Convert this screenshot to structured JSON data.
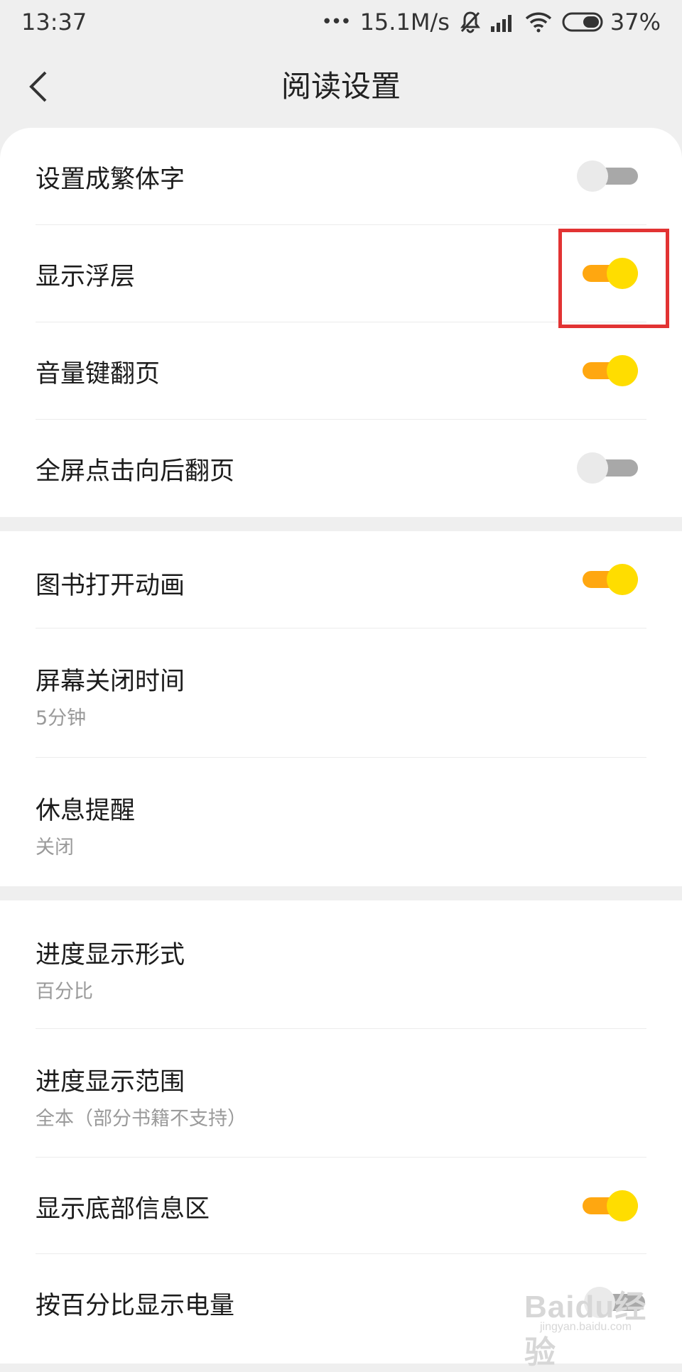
{
  "status_bar": {
    "time": "13:37",
    "dots": "•••",
    "speed": "15.1M/s",
    "battery_percent": "37%",
    "icons": [
      "more-dots-icon",
      "mute-bell-icon",
      "signal-icon",
      "wifi-icon",
      "battery-icon"
    ]
  },
  "nav": {
    "title": "阅读设置"
  },
  "settings": {
    "traditional": {
      "label": "设置成繁体字",
      "enabled": false
    },
    "overlay": {
      "label": "显示浮层",
      "enabled": true
    },
    "volume_key": {
      "label": "音量键翻页",
      "enabled": true
    },
    "fullscreen_tap": {
      "label": "全屏点击向后翻页",
      "enabled": false
    },
    "book_anim": {
      "label": "图书打开动画",
      "enabled": true
    },
    "screen_off": {
      "label": "屏幕关闭时间",
      "value": "5分钟"
    },
    "rest_reminder": {
      "label": "休息提醒",
      "value": "关闭"
    },
    "progress_format": {
      "label": "进度显示形式",
      "value": "百分比"
    },
    "progress_range": {
      "label": "进度显示范围",
      "value": "全本（部分书籍不支持）"
    },
    "bottom_info": {
      "label": "显示底部信息区",
      "enabled": true
    },
    "battery_percent": {
      "label": "按百分比显示电量",
      "enabled": false
    }
  },
  "watermark": {
    "brand": "Baidu经验",
    "url": "jingyan.baidu.com"
  },
  "colors": {
    "switch_on_track": "#ffa710",
    "switch_on_knob": "#ffdd00",
    "switch_off_track": "#a8a8a8",
    "switch_off_knob": "#eaeaea",
    "highlight": "#e23333"
  }
}
